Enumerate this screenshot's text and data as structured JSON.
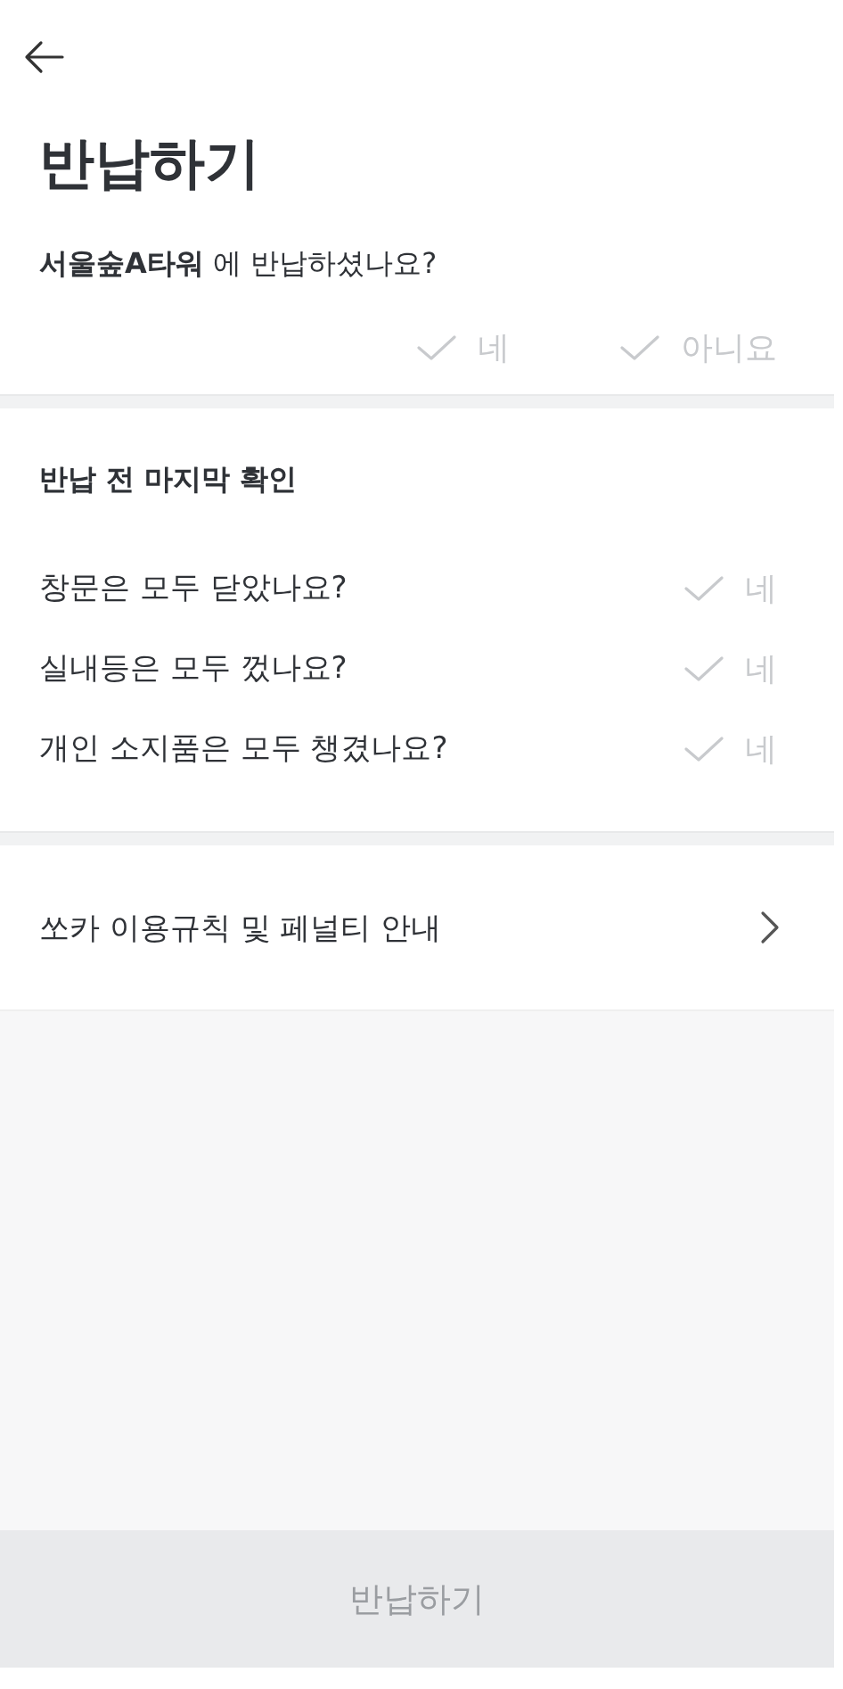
{
  "header": {
    "title": "반납하기"
  },
  "return_question": {
    "text": "**서울숲A타워** 에 반납하셨나요?",
    "options": [
      {
        "label": "네",
        "checked": false
      },
      {
        "label": "아니요",
        "checked": false
      }
    ]
  },
  "final_check": {
    "heading": "반납 전 마지막 확인",
    "items": [
      {
        "question": "창문은 모두 닫았나요?",
        "answer": "네",
        "checked": false
      },
      {
        "question": "실내등은 모두 껐나요?",
        "answer": "네",
        "checked": false
      },
      {
        "question": "개인 소지품은 모두 챙겼나요?",
        "answer": "네",
        "checked": false
      }
    ]
  },
  "link": {
    "label": "쏘카 이용규칙 및 페널티 안내"
  },
  "submit": {
    "label": "반납하기",
    "disabled": true
  }
}
